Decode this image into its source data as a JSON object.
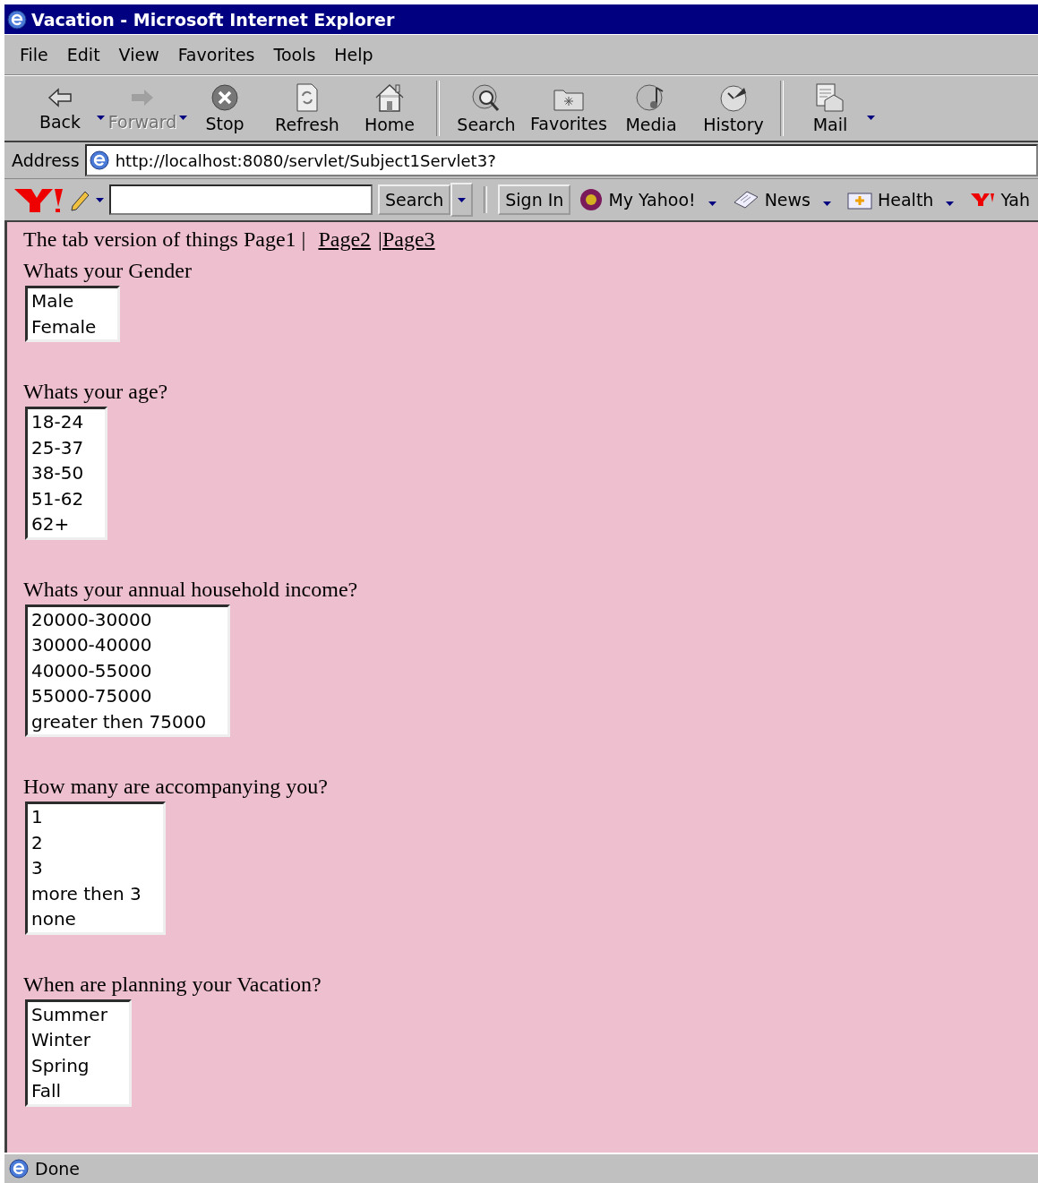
{
  "window": {
    "title": "Vacation - Microsoft Internet Explorer"
  },
  "menu": [
    "File",
    "Edit",
    "View",
    "Favorites",
    "Tools",
    "Help"
  ],
  "toolbar": [
    {
      "label": "Back",
      "disabled": false,
      "dropdown": true
    },
    {
      "label": "Forward",
      "disabled": true,
      "dropdown": true
    },
    {
      "label": "Stop",
      "disabled": false,
      "dropdown": false
    },
    {
      "label": "Refresh",
      "disabled": false,
      "dropdown": false
    },
    {
      "label": "Home",
      "disabled": false,
      "dropdown": false
    },
    {
      "label": "Search",
      "disabled": false,
      "dropdown": false
    },
    {
      "label": "Favorites",
      "disabled": false,
      "dropdown": false
    },
    {
      "label": "Media",
      "disabled": false,
      "dropdown": false
    },
    {
      "label": "History",
      "disabled": false,
      "dropdown": false
    },
    {
      "label": "Mail",
      "disabled": false,
      "dropdown": true
    }
  ],
  "address": {
    "label": "Address",
    "url": "http://localhost:8080/servlet/Subject1Servlet3?"
  },
  "yahoo_bar": {
    "search_button": "Search",
    "sign_in": "Sign In",
    "items": [
      {
        "label": "My Yahoo!"
      },
      {
        "label": "News"
      },
      {
        "label": "Health"
      },
      {
        "label": "Yah"
      }
    ]
  },
  "page": {
    "intro": "The tab version of things Page1 |",
    "links": [
      {
        "text": "Page2"
      },
      {
        "text": "Page3",
        "separator": "|"
      }
    ],
    "questions": [
      {
        "label": "Whats your Gender",
        "options": [
          "Male",
          "Female"
        ]
      },
      {
        "label": "Whats your age?",
        "options": [
          "18-24",
          "25-37",
          "38-50",
          "51-62",
          "62+"
        ]
      },
      {
        "label": "Whats your annual household income?",
        "options": [
          "20000-30000",
          "30000-40000",
          "40000-55000",
          "55000-75000",
          "greater then 75000"
        ]
      },
      {
        "label": "How many are accompanying you?",
        "options": [
          "1",
          "2",
          "3",
          "more then 3",
          "none"
        ]
      },
      {
        "label": "When are planning your Vacation?",
        "options": [
          "Summer",
          "Winter",
          "Spring",
          "Fall"
        ]
      }
    ]
  },
  "status_bar": {
    "text": "Done"
  }
}
